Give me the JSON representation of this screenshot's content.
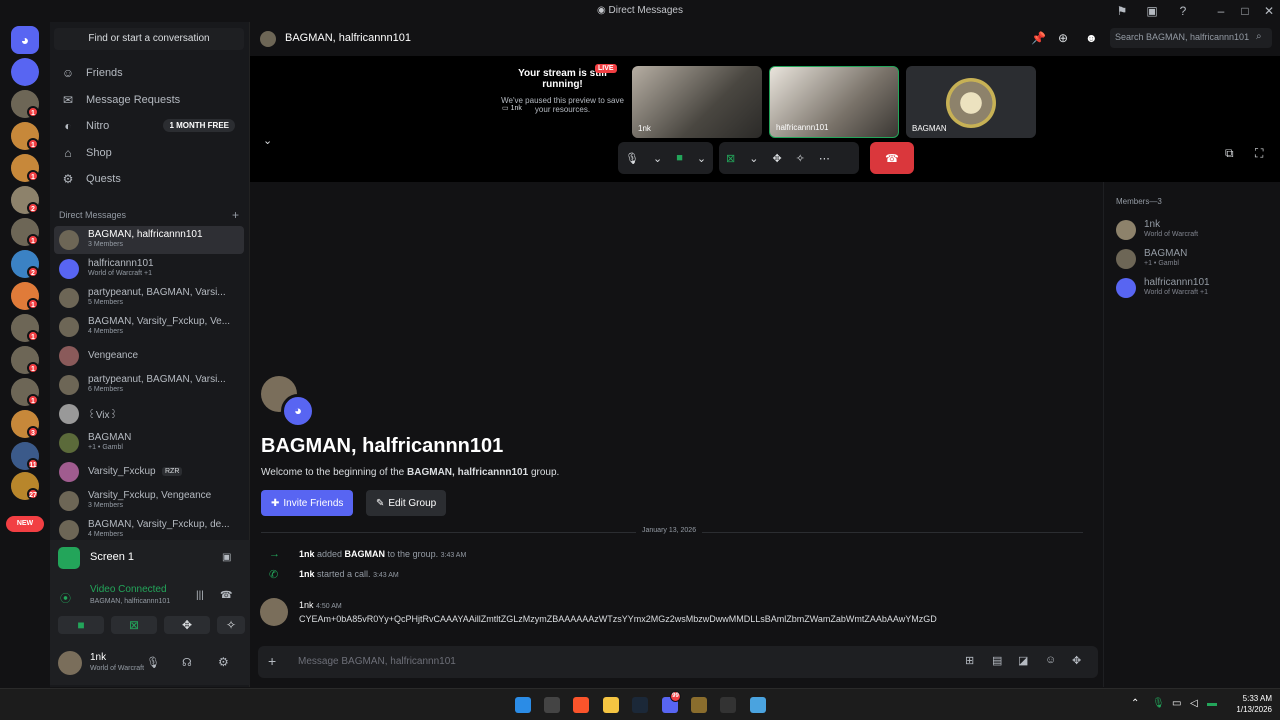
{
  "window": {
    "title": "Direct Messages"
  },
  "sidebar": {
    "find": "Find or start a conversation",
    "nav": [
      {
        "label": "Friends",
        "icon": "friends-icon"
      },
      {
        "label": "Message Requests",
        "icon": "mail-icon"
      },
      {
        "label": "Nitro",
        "icon": "nitro-icon",
        "badge": "1 MONTH FREE"
      },
      {
        "label": "Shop",
        "icon": "shop-icon"
      },
      {
        "label": "Quests",
        "icon": "quests-icon"
      }
    ],
    "dm_header": "Direct Messages",
    "dms": [
      {
        "name": "BAGMAN, halfricannn101",
        "sub": "3 Members"
      },
      {
        "name": "halfricannn101",
        "sub": "World of Warcraft +1"
      },
      {
        "name": "partypeanut, BAGMAN, Varsi...",
        "sub": "5 Members"
      },
      {
        "name": "BAGMAN, Varsity_Fxckup, Ve...",
        "sub": "4 Members"
      },
      {
        "name": "Vengeance",
        "sub": ""
      },
      {
        "name": "partypeanut, BAGMAN, Varsi...",
        "sub": "6 Members"
      },
      {
        "name": "꒰Vix꒱ ",
        "sub": ""
      },
      {
        "name": "BAGMAN",
        "sub": "+1 • Gambl"
      },
      {
        "name": "Varsity_Fxckup",
        "sub": "",
        "tag": "RZR"
      },
      {
        "name": "Varsity_Fxckup, Vengeance",
        "sub": "3 Members"
      },
      {
        "name": "BAGMAN, Varsity_Fxckup, de...",
        "sub": "4 Members"
      }
    ],
    "guild_badges": [
      "1",
      "1",
      "1",
      "2",
      "1",
      "2",
      "1",
      "1",
      "1",
      "1",
      "3",
      "11",
      "27"
    ],
    "new_label": "NEW"
  },
  "voice": {
    "screen": "Screen 1",
    "status": "Video Connected",
    "channel": "BAGMAN, halfricannn101",
    "user": "1nk",
    "user_status": "World of Warcraft"
  },
  "header": {
    "title": "BAGMAN, halfricannn101",
    "search_placeholder": "Search BAGMAN, halfricannn101"
  },
  "stage": {
    "stream_title": "Your stream is still running!",
    "stream_body": "We've paused this preview to save your resources.",
    "stream_user": "1nk",
    "live": "LIVE",
    "tiles": [
      "1nk",
      "halfricannn101",
      "BAGMAN"
    ]
  },
  "intro": {
    "title": "BAGMAN, halfricannn101",
    "welcome_pre": "Welcome to the beginning of the ",
    "welcome_bold": "BAGMAN, halfricannn101",
    "welcome_post": " group.",
    "invite": "Invite Friends",
    "edit": "Edit Group"
  },
  "divider": "January 13, 2026",
  "system": [
    {
      "user": "1nk",
      "mid": " added ",
      "target": "BAGMAN",
      "post": " to the group.",
      "time": "3:43 AM"
    },
    {
      "user": "1nk",
      "mid": " started a call.",
      "target": "",
      "post": "",
      "time": "3:43 AM"
    }
  ],
  "message": {
    "user": "1nk",
    "time": "4:50 AM",
    "text": "CYEAm+0bA85vR0Yy+QcPHjtRvCAAAYAAillZmtltZGLzMzymZBAAAAAAzWTzsYYmx2MGz2wsMbzwDwwMMDLLsBAmlZbmZWamZabWmtZAAbAAwYMzGD"
  },
  "composer": {
    "placeholder": "Message BAGMAN, halfricannn101"
  },
  "members": {
    "header": "Members—3",
    "list": [
      {
        "name": "1nk",
        "sub": "World of Warcraft"
      },
      {
        "name": "BAGMAN",
        "sub": "+1 • Gambl"
      },
      {
        "name": "halfricannn101",
        "sub": "World of Warcraft +1"
      }
    ]
  },
  "taskbar": {
    "time": "5:33 AM",
    "date": "1/13/2026",
    "steam_badge": "99"
  },
  "colors": {
    "blurple": "#5865f2",
    "green": "#23a55a",
    "red": "#da373c"
  }
}
